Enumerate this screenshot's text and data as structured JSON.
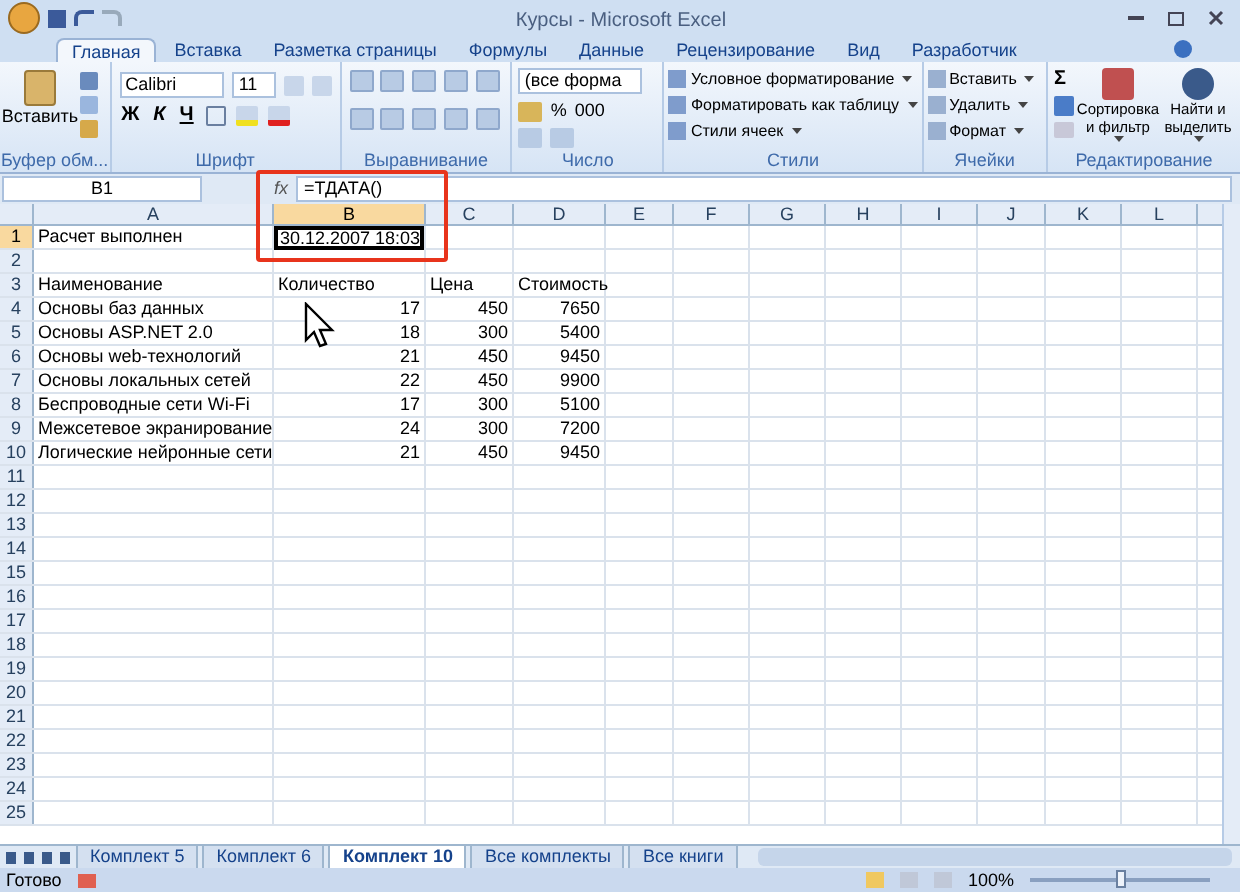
{
  "window": {
    "title": "Курсы - Microsoft Excel"
  },
  "ribbon_tabs": [
    {
      "label": "Главная",
      "selected": true
    },
    {
      "label": "Вставка",
      "selected": false
    },
    {
      "label": "Разметка страницы",
      "selected": false
    },
    {
      "label": "Формулы",
      "selected": false
    },
    {
      "label": "Данные",
      "selected": false
    },
    {
      "label": "Рецензирование",
      "selected": false
    },
    {
      "label": "Вид",
      "selected": false
    },
    {
      "label": "Разработчик",
      "selected": false
    }
  ],
  "ribbon": {
    "clipboard": {
      "label": "Буфер обм...",
      "paste": "Вставить"
    },
    "font": {
      "label": "Шрифт",
      "name": "Calibri",
      "size": "11",
      "bold": "Ж",
      "italic": "К",
      "underline": "Ч"
    },
    "alignment": {
      "label": "Выравнивание"
    },
    "number": {
      "label": "Число",
      "format": "(все форма",
      "percent": "%",
      "thousands": "000"
    },
    "styles": {
      "label": "Стили",
      "items": [
        "Условное форматирование",
        "Форматировать как таблицу",
        "Стили ячеек"
      ]
    },
    "cells": {
      "label": "Ячейки",
      "items": [
        "Вставить",
        "Удалить",
        "Формат"
      ]
    },
    "editing": {
      "label": "Редактирование",
      "sum": "Σ",
      "sort": "Сортировка и фильтр",
      "find": "Найти и выделить"
    }
  },
  "formula_bar": {
    "name_box": "B1",
    "fx": "fx",
    "formula": "=ТДАТА()"
  },
  "columns": [
    {
      "label": "A",
      "selected": false
    },
    {
      "label": "B",
      "selected": true
    },
    {
      "label": "C",
      "selected": false
    },
    {
      "label": "D",
      "selected": false
    },
    {
      "label": "E",
      "selected": false
    },
    {
      "label": "F",
      "selected": false
    },
    {
      "label": "G",
      "selected": false
    },
    {
      "label": "H",
      "selected": false
    },
    {
      "label": "I",
      "selected": false
    },
    {
      "label": "J",
      "selected": false
    },
    {
      "label": "K",
      "selected": false
    },
    {
      "label": "L",
      "selected": false
    }
  ],
  "rows": [
    {
      "label": "1",
      "selected": true,
      "cells": {
        "A": {
          "text": "Расчет выполнен",
          "kind": "text"
        },
        "B": {
          "text": "30.12.2007 18:03",
          "kind": "number",
          "active": true
        }
      }
    },
    {
      "label": "2",
      "selected": false
    },
    {
      "label": "3",
      "selected": false,
      "cells": {
        "A": {
          "text": "Наименование",
          "kind": "text"
        },
        "B": {
          "text": "Количество",
          "kind": "text"
        },
        "C": {
          "text": "Цена",
          "kind": "text"
        },
        "D": {
          "text": "Стоимость",
          "kind": "text"
        }
      }
    },
    {
      "label": "4",
      "selected": false,
      "cells": {
        "A": {
          "text": "Основы баз данных",
          "kind": "text"
        },
        "B": {
          "text": "17",
          "kind": "number"
        },
        "C": {
          "text": "450",
          "kind": "number"
        },
        "D": {
          "text": "7650",
          "kind": "number"
        }
      }
    },
    {
      "label": "5",
      "selected": false,
      "cells": {
        "A": {
          "text": "Основы ASP.NET 2.0",
          "kind": "text"
        },
        "B": {
          "text": "18",
          "kind": "number"
        },
        "C": {
          "text": "300",
          "kind": "number"
        },
        "D": {
          "text": "5400",
          "kind": "number"
        }
      }
    },
    {
      "label": "6",
      "selected": false,
      "cells": {
        "A": {
          "text": "Основы web-технологий",
          "kind": "text"
        },
        "B": {
          "text": "21",
          "kind": "number"
        },
        "C": {
          "text": "450",
          "kind": "number"
        },
        "D": {
          "text": "9450",
          "kind": "number"
        }
      }
    },
    {
      "label": "7",
      "selected": false,
      "cells": {
        "A": {
          "text": "Основы локальных сетей",
          "kind": "text"
        },
        "B": {
          "text": "22",
          "kind": "number"
        },
        "C": {
          "text": "450",
          "kind": "number"
        },
        "D": {
          "text": "9900",
          "kind": "number"
        }
      }
    },
    {
      "label": "8",
      "selected": false,
      "cells": {
        "A": {
          "text": "Беспроводные сети Wi-Fi",
          "kind": "text"
        },
        "B": {
          "text": "17",
          "kind": "number"
        },
        "C": {
          "text": "300",
          "kind": "number"
        },
        "D": {
          "text": "5100",
          "kind": "number"
        }
      }
    },
    {
      "label": "9",
      "selected": false,
      "cells": {
        "A": {
          "text": "Межсетевое экранирование",
          "kind": "text"
        },
        "B": {
          "text": "24",
          "kind": "number"
        },
        "C": {
          "text": "300",
          "kind": "number"
        },
        "D": {
          "text": "7200",
          "kind": "number"
        }
      }
    },
    {
      "label": "10",
      "selected": false,
      "cells": {
        "A": {
          "text": "Логические нейронные сети",
          "kind": "text"
        },
        "B": {
          "text": "21",
          "kind": "number"
        },
        "C": {
          "text": "450",
          "kind": "number"
        },
        "D": {
          "text": "9450",
          "kind": "number"
        }
      }
    },
    {
      "label": "11",
      "selected": false
    },
    {
      "label": "12",
      "selected": false
    },
    {
      "label": "13",
      "selected": false
    },
    {
      "label": "14",
      "selected": false
    },
    {
      "label": "15",
      "selected": false
    },
    {
      "label": "16",
      "selected": false
    },
    {
      "label": "17",
      "selected": false
    },
    {
      "label": "18",
      "selected": false
    },
    {
      "label": "19",
      "selected": false
    },
    {
      "label": "20",
      "selected": false
    },
    {
      "label": "21",
      "selected": false
    },
    {
      "label": "22",
      "selected": false
    },
    {
      "label": "23",
      "selected": false
    },
    {
      "label": "24",
      "selected": false
    },
    {
      "label": "25",
      "selected": false
    }
  ],
  "sheet_tabs": [
    {
      "label": "Комплект 5",
      "selected": false
    },
    {
      "label": "Комплект 6",
      "selected": false
    },
    {
      "label": "Комплект 10",
      "selected": true
    },
    {
      "label": "Все комплекты",
      "selected": false
    },
    {
      "label": "Все книги",
      "selected": false
    }
  ],
  "status_bar": {
    "text": "Готово",
    "zoom": "100%",
    "zoom_slider": {
      "level": 0.5
    }
  }
}
